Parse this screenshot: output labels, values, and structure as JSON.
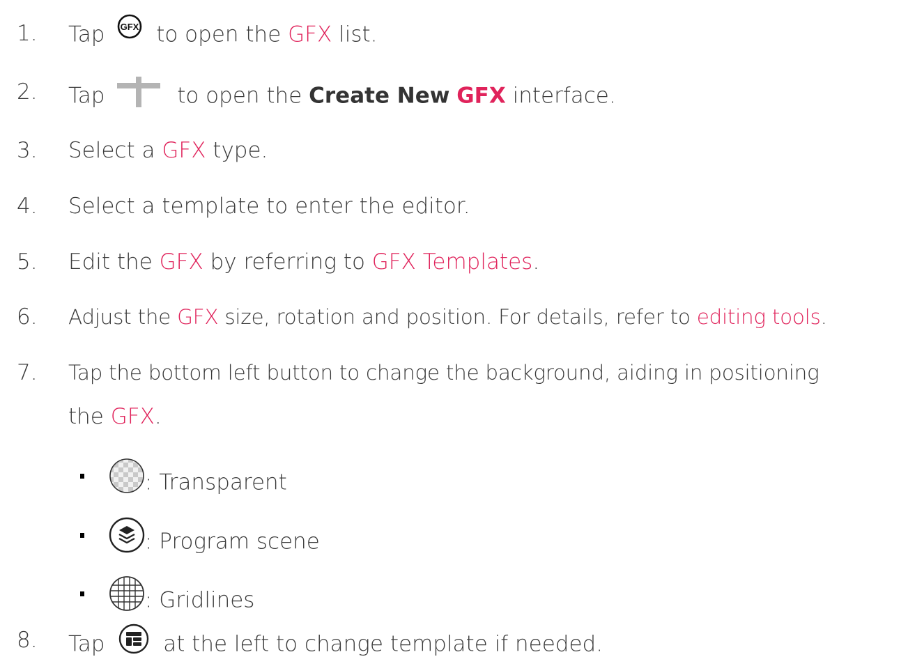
{
  "steps": [
    {
      "num": "1.",
      "parts": [
        "Tap",
        "to open the",
        "GFX",
        "list."
      ]
    },
    {
      "num": "2.",
      "parts": [
        "Tap",
        "to open the",
        "Create New",
        "GFX",
        "interface."
      ]
    },
    {
      "num": "3.",
      "parts": [
        "Select a",
        "GFX",
        "type."
      ]
    },
    {
      "num": "4.",
      "parts": [
        "Select a template to enter the editor."
      ]
    },
    {
      "num": "5.",
      "parts": [
        "Edit the",
        "GFX",
        "by referring to",
        "GFX Templates",
        "."
      ]
    },
    {
      "num": "6.",
      "parts": [
        "Adjust the",
        "GFX",
        "size, rotation and position. For details, refer to",
        "editing tools",
        "."
      ]
    },
    {
      "num": "7.",
      "parts": [
        "Tap the bottom left button to change the background, aiding in positioning",
        "the",
        "GFX",
        "."
      ]
    },
    {
      "num": "8.",
      "parts": [
        "Tap",
        "at the left to change template if needed."
      ]
    }
  ],
  "icons": {
    "gfx_icon_label": "GFX",
    "gfx_icon": "gfx-circle-icon",
    "plus_icon": "plus-icon",
    "transparent_icon": "checkerboard-circle-icon",
    "program_scene_icon": "layers-circle-icon",
    "gridlines_icon": "grid-circle-icon",
    "template_icon": "template-circle-icon"
  },
  "background_options": [
    {
      "label": ": Transparent"
    },
    {
      "label": ": Program scene"
    },
    {
      "label": ": Gridlines"
    }
  ],
  "colors": {
    "accent": "#e0235b",
    "text": "#3a3a3a"
  }
}
